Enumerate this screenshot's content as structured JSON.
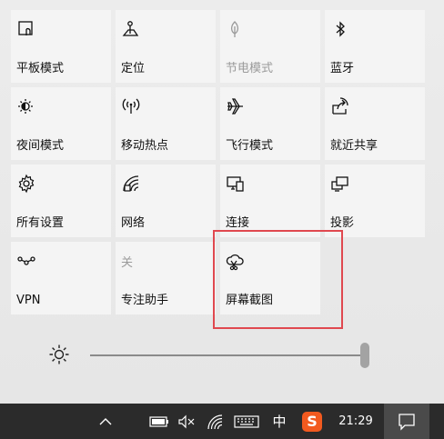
{
  "tiles": [
    {
      "label": "平板模式",
      "icon": "tablet-mode-icon"
    },
    {
      "label": "定位",
      "icon": "location-icon"
    },
    {
      "label": "节电模式",
      "icon": "battery-saver-icon",
      "disabled": true
    },
    {
      "label": "蓝牙",
      "icon": "bluetooth-icon"
    },
    {
      "label": "夜间模式",
      "icon": "night-light-icon"
    },
    {
      "label": "移动热点",
      "icon": "mobile-hotspot-icon"
    },
    {
      "label": "飞行模式",
      "icon": "airplane-mode-icon"
    },
    {
      "label": "就近共享",
      "icon": "nearby-sharing-icon"
    },
    {
      "label": "所有设置",
      "icon": "settings-gear-icon"
    },
    {
      "label": "网络",
      "icon": "network-icon"
    },
    {
      "label": "连接",
      "icon": "connect-icon"
    },
    {
      "label": "投影",
      "icon": "project-icon"
    },
    {
      "label": "VPN",
      "icon": "vpn-icon"
    },
    {
      "label": "专注助手",
      "icon": "focus-assist-icon",
      "state": "关"
    },
    {
      "label": "屏幕截图",
      "icon": "screen-snip-icon"
    }
  ],
  "brightness": {
    "icon": "brightness-sun-icon",
    "level": 1.0
  },
  "taskbar": {
    "show_hidden_icon": "chevron-up-icon",
    "battery_icon": "battery-icon",
    "volume_icon": "volume-muted-icon",
    "wifi_icon": "wifi-icon",
    "keyboard_icon": "touch-keyboard-icon",
    "ime_label": "中",
    "sogou_label": "S",
    "time": "21:29",
    "notification_icon": "action-center-icon"
  },
  "colors": {
    "highlight": "#e0484f",
    "sogou": "#f25a1f"
  }
}
